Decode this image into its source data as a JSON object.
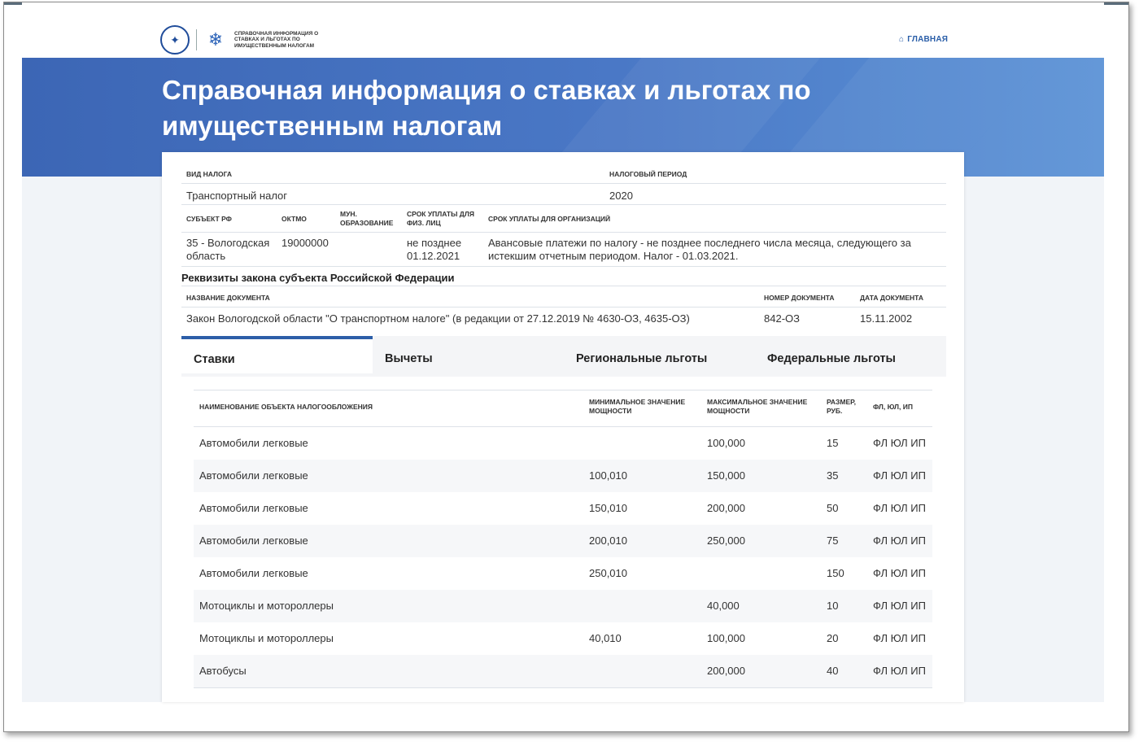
{
  "header": {
    "logo_text": "Справочная информация о ставках и льготах по имущественным налогам",
    "home_label": "ГЛАВНАЯ"
  },
  "banner": {
    "title": "Справочная информация о ставках и льготах по имущественным налогам"
  },
  "info": {
    "labels": {
      "tax_type": "ВИД НАЛОГА",
      "tax_period": "НАЛОГОВЫЙ ПЕРИОД",
      "subject": "СУБЪЕКТ РФ",
      "oktmo": "ОКТМО",
      "mun_line1": "МУН.",
      "mun_line2": "ОБРАЗОВАНИЕ",
      "deadline_fl_line1": "СРОК УПЛАТЫ ДЛЯ",
      "deadline_fl_line2": "ФИЗ. ЛИЦ",
      "deadline_org": "СРОК УПЛАТЫ ДЛЯ ОРГАНИЗАЦИЙ"
    },
    "values": {
      "tax_type": "Транспортный налог",
      "tax_period": "2020",
      "subject_line1": "35 - Вологодская",
      "subject_line2": "область",
      "oktmo": "19000000",
      "mun": "",
      "deadline_fl_line1": "не позднее",
      "deadline_fl_line2": "01.12.2021",
      "deadline_org_line1": "Авансовые платежи по налогу - не позднее последнего числа месяца, следующего за",
      "deadline_org_line2": "истекшим отчетным периодом. Налог - 01.03.2021."
    }
  },
  "law": {
    "section_title": "Реквизиты закона субъекта Российской Федерации",
    "labels": {
      "doc_name": "НАЗВАНИЕ ДОКУМЕНТА",
      "doc_number": "НОМЕР ДОКУМЕНТА",
      "doc_date": "ДАТА ДОКУМЕНТА"
    },
    "doc_name": "Закон Вологодской области \"О транспортном налоге\" (в редакции от 27.12.2019 № 4630-ОЗ, 4635-ОЗ)",
    "doc_number": "842-ОЗ",
    "doc_date": "15.11.2002"
  },
  "tabs": [
    "Ставки",
    "Вычеты",
    "Региональные льготы",
    "Федеральные льготы"
  ],
  "rates_table": {
    "headers": {
      "name": "НАИМЕНОВАНИЕ ОБЪЕКТА НАЛОГООБЛОЖЕНИЯ",
      "min_line1": "МИНИМАЛЬНОЕ ЗНАЧЕНИЕ",
      "min_line2": "МОЩНОСТИ",
      "max_line1": "МАКСИМАЛЬНОЕ ЗНАЧЕНИЕ",
      "max_line2": "МОЩНОСТИ",
      "size_line1": "РАЗМЕР,",
      "size_line2": "РУБ.",
      "who": "ФЛ, ЮЛ, ИП"
    },
    "rows": [
      {
        "name": "Автомобили легковые",
        "min": "",
        "max": "100,000",
        "size": "15",
        "who": "ФЛ ЮЛ ИП"
      },
      {
        "name": "Автомобили легковые",
        "min": "100,010",
        "max": "150,000",
        "size": "35",
        "who": "ФЛ ЮЛ ИП"
      },
      {
        "name": "Автомобили легковые",
        "min": "150,010",
        "max": "200,000",
        "size": "50",
        "who": "ФЛ ЮЛ ИП"
      },
      {
        "name": "Автомобили легковые",
        "min": "200,010",
        "max": "250,000",
        "size": "75",
        "who": "ФЛ ЮЛ ИП"
      },
      {
        "name": "Автомобили легковые",
        "min": "250,010",
        "max": "",
        "size": "150",
        "who": "ФЛ ЮЛ ИП"
      },
      {
        "name": "Мотоциклы и мотороллеры",
        "min": "",
        "max": "40,000",
        "size": "10",
        "who": "ФЛ ЮЛ ИП"
      },
      {
        "name": "Мотоциклы и мотороллеры",
        "min": "40,010",
        "max": "100,000",
        "size": "20",
        "who": "ФЛ ЮЛ ИП"
      },
      {
        "name": "Автобусы",
        "min": "",
        "max": "200,000",
        "size": "40",
        "who": "ФЛ ЮЛ ИП"
      }
    ]
  }
}
